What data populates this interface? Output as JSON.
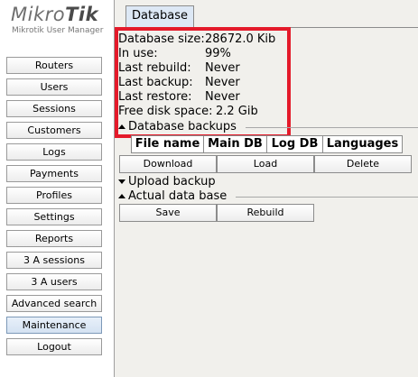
{
  "logo": {
    "brand_light": "Mikro",
    "brand_bold": "Tik",
    "subtitle": "Mikrotik User Manager"
  },
  "sidebar": {
    "items": [
      {
        "label": "Routers"
      },
      {
        "label": "Users"
      },
      {
        "label": "Sessions"
      },
      {
        "label": "Customers"
      },
      {
        "label": "Logs"
      },
      {
        "label": "Payments"
      },
      {
        "label": "Profiles"
      },
      {
        "label": "Settings"
      },
      {
        "label": "Reports"
      },
      {
        "label": "3 A sessions"
      },
      {
        "label": "3 A users"
      },
      {
        "label": "Advanced search"
      },
      {
        "label": "Maintenance",
        "active": true
      },
      {
        "label": "Logout"
      }
    ]
  },
  "main": {
    "tab_label": "Database",
    "info": [
      {
        "label": "Database size:",
        "value": "28672.0 Kib"
      },
      {
        "label": "In use:",
        "value": "99%"
      },
      {
        "label": "Last rebuild:",
        "value": "Never"
      },
      {
        "label": "Last backup:",
        "value": "Never"
      },
      {
        "label": "Last restore:",
        "value": "Never"
      },
      {
        "label": "Free disk space:",
        "value": "2.2 Gib"
      }
    ],
    "backups_section": {
      "title": "Database backups",
      "columns": [
        "File name",
        "Main DB",
        "Log DB",
        "Languages"
      ],
      "buttons": {
        "download": "Download",
        "load": "Load",
        "delete": "Delete"
      }
    },
    "upload_section": {
      "title": "Upload backup"
    },
    "actual_section": {
      "title": "Actual data base",
      "buttons": {
        "save": "Save",
        "rebuild": "Rebuild"
      }
    }
  },
  "colors": {
    "highlight": "#e41a2a",
    "panel_bg": "#f1f0ec",
    "tab_bg": "#dde8f5",
    "active_nav": "#d4e2f2"
  }
}
